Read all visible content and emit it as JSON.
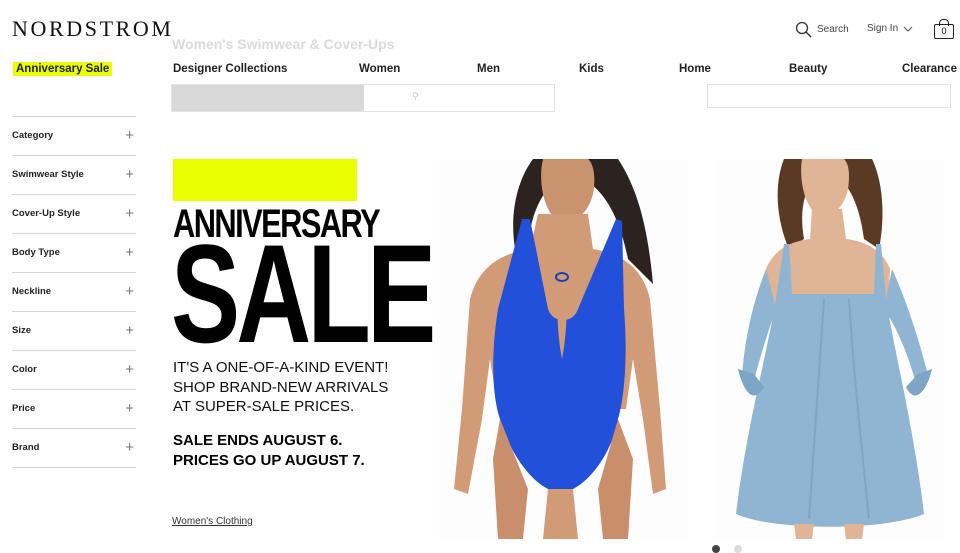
{
  "header": {
    "logo": "NORDSTROM",
    "search_label": "Search",
    "signin_label": "Sign In",
    "bag_count": "0"
  },
  "nav": [
    {
      "label": "Anniversary Sale",
      "highlight_color": "#eaff00"
    },
    {
      "label": "Designer Collections"
    },
    {
      "label": "Women"
    },
    {
      "label": "Men"
    },
    {
      "label": "Kids"
    },
    {
      "label": "Home"
    },
    {
      "label": "Beauty"
    },
    {
      "label": "Clearance"
    }
  ],
  "background_page": {
    "title": "Women's Swimwear & Cover-Ups"
  },
  "filters": [
    {
      "label": "Category"
    },
    {
      "label": "Swimwear Style"
    },
    {
      "label": "Cover-Up Style"
    },
    {
      "label": "Body Type"
    },
    {
      "label": "Neckline"
    },
    {
      "label": "Size"
    },
    {
      "label": "Color"
    },
    {
      "label": "Price"
    },
    {
      "label": "Brand"
    }
  ],
  "promo": {
    "heading_line1": "ANNIVERSARY",
    "heading_line2": "SALE",
    "body_lines": [
      "IT'S A ONE-OF-A-KIND EVENT!",
      "SHOP BRAND-NEW ARRIVALS",
      "AT SUPER-SALE PRICES."
    ],
    "deadline_lines": [
      "SALE ENDS AUGUST 6.",
      "PRICES GO UP AUGUST 7."
    ],
    "link": "Women's Clothing",
    "accent_color": "#eaff00"
  },
  "products": [
    {
      "image": "blue-plunge-one-piece-swimsuit",
      "color": "#2250d8"
    },
    {
      "image": "light-blue-cold-shoulder-dress",
      "color": "#8fb5d2"
    }
  ]
}
